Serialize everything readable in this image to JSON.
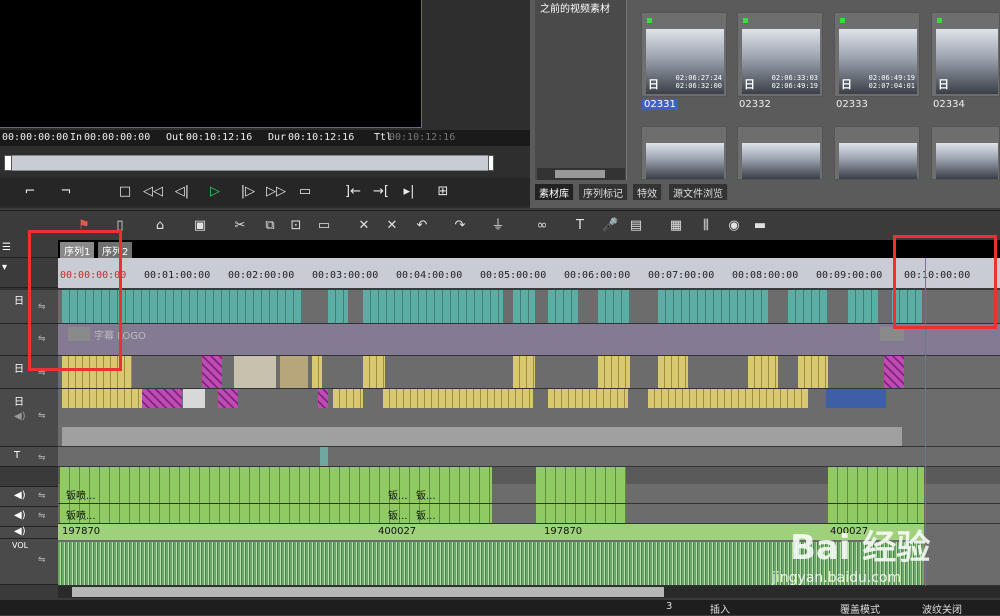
{
  "player": {
    "timecodes": {
      "current": "00:00:00:00",
      "in_label": "In",
      "in_value": "00:00:00:00",
      "out_label": "Out",
      "out_value": "00:10:12:16",
      "dur_label": "Dur",
      "dur_value": "00:10:12:16",
      "ttl_label": "Ttl",
      "ttl_value": "00:10:12:16"
    },
    "transport_icons": [
      "mark-in-icon",
      "mark-out-icon",
      "stop-icon",
      "rewind-icon",
      "step-back-icon",
      "play-icon",
      "step-forward-icon",
      "fast-forward-icon",
      "loop-icon",
      "go-in-icon",
      "go-out-icon",
      "split-icon",
      "match-frame-icon"
    ]
  },
  "bin": {
    "folder_title": "之前的视频素材",
    "clips": [
      {
        "label": "02331",
        "selected": true,
        "day": "日",
        "tc_in": "02:06:27:24",
        "tc_out": "02:06:32:00"
      },
      {
        "label": "02332",
        "selected": false,
        "day": "日",
        "tc_in": "02:06:33:03",
        "tc_out": "02:06:49:19"
      },
      {
        "label": "02333",
        "selected": false,
        "day": "日",
        "tc_in": "02:06:49:19",
        "tc_out": "02:07:04:01"
      },
      {
        "label": "02334",
        "selected": false,
        "day": "日",
        "tc_in": "",
        "tc_out": ""
      }
    ],
    "tabs": [
      "素材库",
      "序列标记",
      "特效",
      "源文件浏览"
    ],
    "active_tab": "素材库"
  },
  "sequence_tabs": [
    "序列1",
    "序列2"
  ],
  "active_sequence": "序列1",
  "tracks": {
    "headers": [
      "",
      "日",
      "",
      "日",
      "日",
      "T",
      "",
      "",
      "",
      "VOL"
    ],
    "title_clip": "字幕 LOGO",
    "audio_labels": [
      "钣喷...",
      "钣...",
      "钣..."
    ],
    "audio_numbers": [
      "197870",
      "400027",
      "197870",
      "400027"
    ]
  },
  "ruler": {
    "ticks": [
      "00:00:00:00",
      "00:01:00:00",
      "00:02:00:00",
      "00:03:00:00",
      "00:04:00:00",
      "00:05:00:00",
      "00:06:00:00",
      "00:07:00:00",
      "00:08:00:00",
      "00:09:00:00",
      "00:10:00:00"
    ]
  },
  "statusbar": {
    "items": [
      "3",
      "插入",
      "覆盖模式",
      "波纹关闭"
    ]
  },
  "watermark": {
    "brand": "Bai 经验",
    "url": "jingyan.baidu.com"
  },
  "colors": {
    "accent_blue": "#3b62c8",
    "annotation_red": "#ee3030",
    "play_green": "#39d35a",
    "video_cyan": "#5aaea3",
    "audio_green": "#8fcb62"
  }
}
